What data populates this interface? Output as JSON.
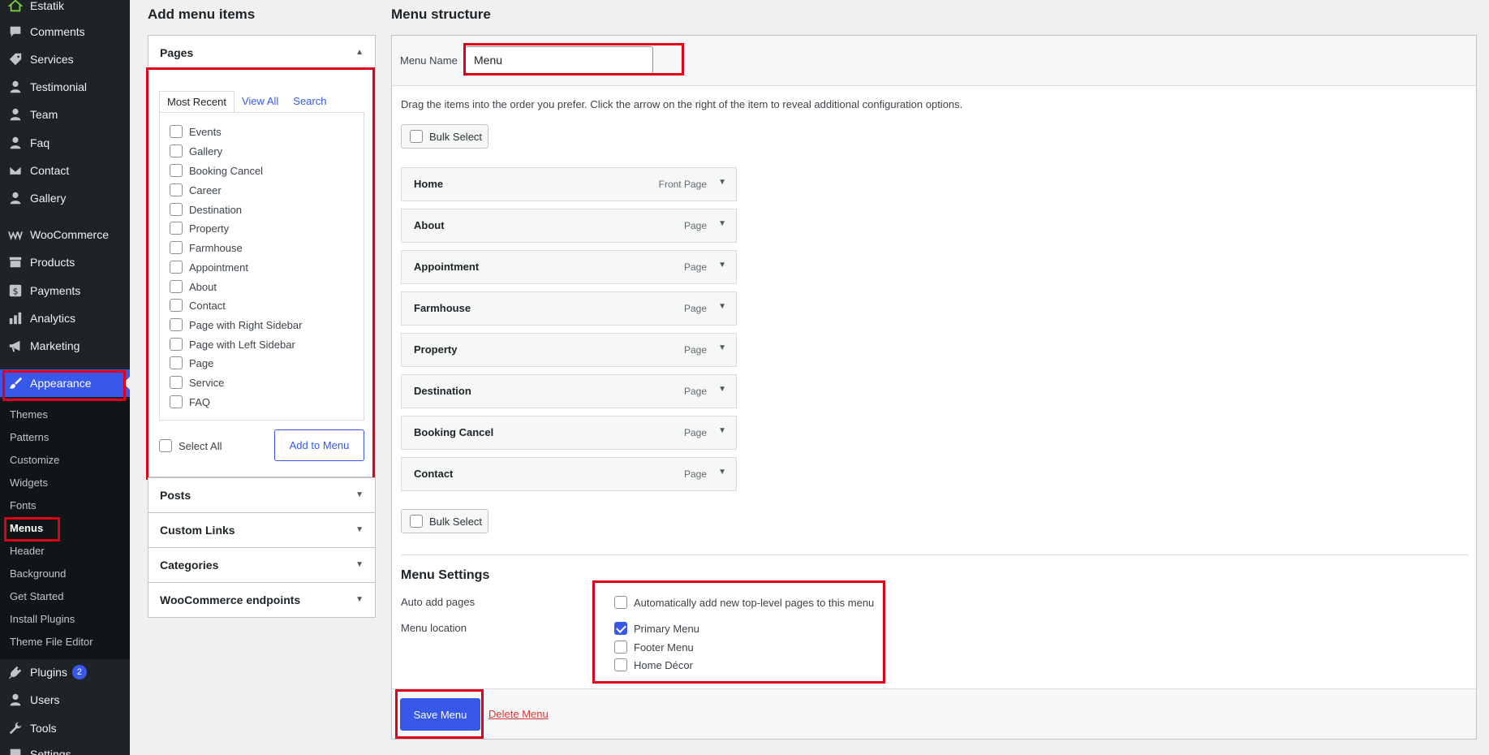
{
  "sidebar": {
    "items": [
      {
        "label": "Estatik",
        "icon": "house-icon"
      },
      {
        "label": "Comments",
        "icon": "comment-icon"
      },
      {
        "label": "Services",
        "icon": "tag-icon"
      },
      {
        "label": "Testimonial",
        "icon": "user-icon"
      },
      {
        "label": "Team",
        "icon": "user-icon"
      },
      {
        "label": "Faq",
        "icon": "user-icon"
      },
      {
        "label": "Contact",
        "icon": "mail-icon"
      },
      {
        "label": "Gallery",
        "icon": "user-icon"
      },
      {
        "label": "WooCommerce",
        "icon": "woo-icon"
      },
      {
        "label": "Products",
        "icon": "archive-icon"
      },
      {
        "label": "Payments",
        "icon": "dollar-icon"
      },
      {
        "label": "Analytics",
        "icon": "bar-chart-icon"
      },
      {
        "label": "Marketing",
        "icon": "megaphone-icon"
      },
      {
        "label": "Appearance",
        "icon": "brush-icon"
      }
    ],
    "submenu": [
      "Themes",
      "Patterns",
      "Customize",
      "Widgets",
      "Fonts",
      "Menus",
      "Header",
      "Background",
      "Get Started",
      "Install Plugins",
      "Theme File Editor"
    ],
    "bottom": [
      {
        "label": "Plugins",
        "icon": "plug-icon",
        "badge": "2"
      },
      {
        "label": "Users",
        "icon": "user-icon"
      },
      {
        "label": "Tools",
        "icon": "wrench-icon"
      },
      {
        "label": "Settings",
        "icon": "settings-icon"
      }
    ]
  },
  "add_items": {
    "heading": "Add menu items",
    "pages_title": "Pages",
    "tabs": [
      "Most Recent",
      "View All",
      "Search"
    ],
    "pages": [
      "Events",
      "Gallery",
      "Booking Cancel",
      "Career",
      "Destination",
      "Property",
      "Farmhouse",
      "Appointment",
      "About",
      "Contact",
      "Page with Right Sidebar",
      "Page with Left Sidebar",
      "Page",
      "Service",
      "FAQ"
    ],
    "select_all": "Select All",
    "add_button": "Add to Menu",
    "other_sections": [
      "Posts",
      "Custom Links",
      "Categories",
      "WooCommerce endpoints"
    ]
  },
  "structure": {
    "heading": "Menu structure",
    "menu_name_label": "Menu Name",
    "menu_name_value": "Menu",
    "instructions": "Drag the items into the order you prefer. Click the arrow on the right of the item to reveal additional configuration options.",
    "bulk_select": "Bulk Select",
    "items": [
      {
        "title": "Home",
        "type": "Front Page"
      },
      {
        "title": "About",
        "type": "Page"
      },
      {
        "title": "Appointment",
        "type": "Page"
      },
      {
        "title": "Farmhouse",
        "type": "Page"
      },
      {
        "title": "Property",
        "type": "Page"
      },
      {
        "title": "Destination",
        "type": "Page"
      },
      {
        "title": "Booking Cancel",
        "type": "Page"
      },
      {
        "title": "Contact",
        "type": "Page"
      }
    ],
    "settings_heading": "Menu Settings",
    "auto_add_label": "Auto add pages",
    "auto_add_option": "Automatically add new top-level pages to this menu",
    "location_label": "Menu location",
    "locations": [
      {
        "label": "Primary Menu",
        "checked": true
      },
      {
        "label": "Footer Menu",
        "checked": false
      },
      {
        "label": "Home Décor",
        "checked": false
      }
    ],
    "save_button": "Save Menu",
    "delete_link": "Delete Menu"
  },
  "colors": {
    "accent": "#3858e9",
    "highlight": "#e0001b",
    "sidebar": "#1d2327"
  }
}
